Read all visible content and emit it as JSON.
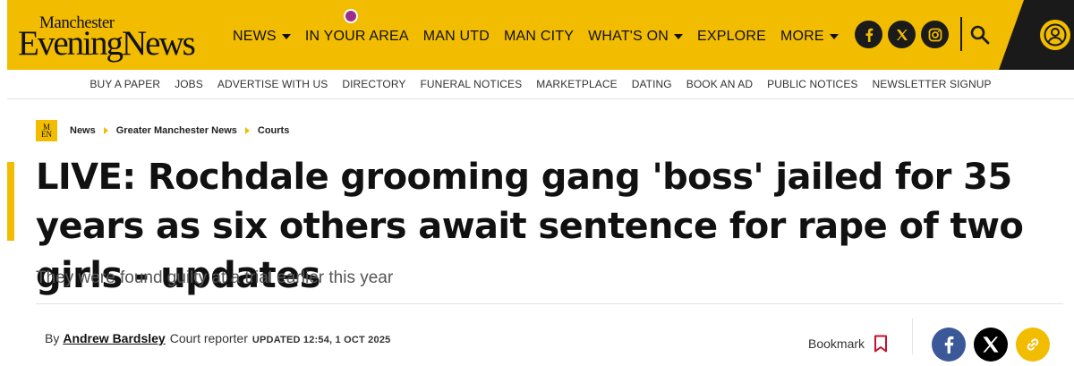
{
  "brand": {
    "logo_top": "Manchester",
    "logo_bottom": "EveningNews",
    "accent_color": "#f2bc00",
    "dark_color": "#1a1a1a"
  },
  "nav": {
    "items": [
      {
        "label": "NEWS",
        "has_dropdown": true
      },
      {
        "label": "IN YOUR AREA",
        "has_dropdown": false
      },
      {
        "label": "MAN UTD",
        "has_dropdown": false
      },
      {
        "label": "MAN CITY",
        "has_dropdown": false
      },
      {
        "label": "WHAT'S ON",
        "has_dropdown": true
      },
      {
        "label": "EXPLORE",
        "has_dropdown": false
      },
      {
        "label": "MORE",
        "has_dropdown": true
      }
    ],
    "social_icons": [
      "facebook-icon",
      "x-icon",
      "instagram-icon"
    ],
    "search_icon": "search-icon",
    "account_icon": "user-icon"
  },
  "subnav": {
    "links": [
      "BUY A PAPER",
      "JOBS",
      "ADVERTISE WITH US",
      "DIRECTORY",
      "FUNERAL NOTICES",
      "MARKETPLACE",
      "DATING",
      "BOOK AN AD",
      "PUBLIC NOTICES",
      "NEWSLETTER SIGNUP"
    ]
  },
  "breadcrumb": {
    "badge_top": "M",
    "badge_bottom": "EN",
    "items": [
      "News",
      "Greater Manchester News",
      "Courts"
    ]
  },
  "article": {
    "headline": "LIVE: Rochdale grooming gang 'boss' jailed for 35 years as six others await sentence for rape of two girls - updates",
    "standfirst": "They were found guilty at a trial earlier this year"
  },
  "byline": {
    "prefix": "By",
    "author": "Andrew Bardsley",
    "role": "Court reporter",
    "updated": "UPDATED 12:54, 1 OCT 2025",
    "bookmark_label": "Bookmark"
  },
  "share": {
    "buttons": [
      "facebook-share-icon",
      "x-share-icon",
      "copy-link-icon"
    ],
    "facebook_color": "#3b5998",
    "x_color": "#000000",
    "link_color": "#f2bc00"
  }
}
